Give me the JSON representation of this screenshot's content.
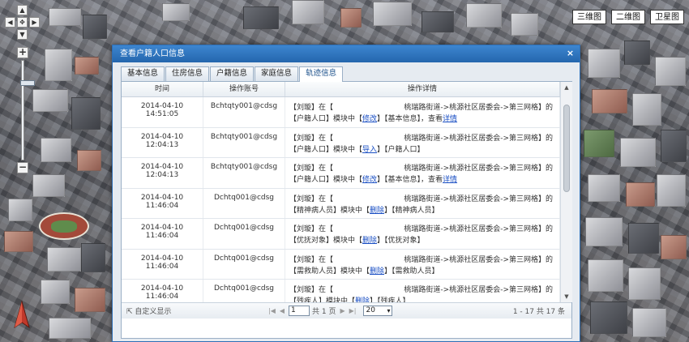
{
  "map_types": [
    "三维图",
    "二维图",
    "卫星图"
  ],
  "map_controls": {
    "up": "▲",
    "down": "▼",
    "left": "◀",
    "right": "▶",
    "center": "✥",
    "zoom_in": "+",
    "zoom_out": "−"
  },
  "zoom_level_fraction": 0.2,
  "dialog": {
    "title": "查看户籍人口信息",
    "close": "×",
    "tabs": [
      "基本信息",
      "住房信息",
      "户籍信息",
      "家庭信息",
      "轨迹信息"
    ],
    "active_tab": 4,
    "columns": [
      "时间",
      "操作账号",
      "操作详情"
    ],
    "rows": [
      {
        "time": "2014-04-10 14:51:05",
        "account": "Bchtqty001@cdsg",
        "l1a": "【刘璇】在【",
        "l1b": "桃瑞路街道->桃源社区居委会->第三网格】的",
        "l2a": "【户籍人口】模块中【",
        "op": "修改",
        "l2b": "】【基本信息】，查看",
        "link": "详情"
      },
      {
        "time": "2014-04-10 12:04:13",
        "account": "Bchtqty001@cdsg",
        "l1a": "【刘璇】在【",
        "l1b": "桃瑞路街道->桃源社区居委会->第三网格】的",
        "l2a": "【户籍人口】模块中【",
        "op": "导入",
        "l2b": "】【户籍人口】",
        "link": ""
      },
      {
        "time": "2014-04-10 12:04:13",
        "account": "Bchtqty001@cdsg",
        "l1a": "【刘璇】在【",
        "l1b": "桃瑞路街道->桃源社区居委会->第三网格】的",
        "l2a": "【户籍人口】模块中【",
        "op": "修改",
        "l2b": "】【基本信息】，查看",
        "link": "详情"
      },
      {
        "time": "2014-04-10 11:46:04",
        "account": "Dchtq001@cdsg",
        "l1a": "【刘璇】在【",
        "l1b": "桃瑞路街道->桃源社区居委会->第三网格】的",
        "l2a": "【精神病人员】模块中【",
        "op": "删除",
        "l2b": "】【精神病人员】",
        "link": ""
      },
      {
        "time": "2014-04-10 11:46:04",
        "account": "Dchtq001@cdsg",
        "l1a": "【刘璇】在【",
        "l1b": "桃瑞路街道->桃源社区居委会->第三网格】的",
        "l2a": "【优抚对象】模块中【",
        "op": "删除",
        "l2b": "】【优抚对象】",
        "link": ""
      },
      {
        "time": "2014-04-10 11:46:04",
        "account": "Dchtq001@cdsg",
        "l1a": "【刘璇】在【",
        "l1b": "桃瑞路街道->桃源社区居委会->第三网格】的",
        "l2a": "【需救助人员】模块中【",
        "op": "删除",
        "l2b": "】【需救助人员】",
        "link": ""
      },
      {
        "time": "2014-04-10 11:46:04",
        "account": "Dchtq001@cdsg",
        "l1a": "【刘璇】在【",
        "l1b": "桃瑞路街道->桃源社区居委会->第三网格】的",
        "l2a": "【残疾人】模块中【",
        "op": "删除",
        "l2b": "】【残疾人】",
        "link": ""
      }
    ],
    "pager": {
      "custom": "自定义显示",
      "first": "|◀",
      "prev": "◀",
      "page": "1",
      "total_pages": "共 1 页",
      "next": "▶",
      "last": "▶|",
      "page_size": "20",
      "info": "1 - 17  共 17 条"
    }
  },
  "colors": {
    "header": "#2466ad",
    "link": "#1a4fc4",
    "dialog_bg": "#e6ebf1"
  }
}
